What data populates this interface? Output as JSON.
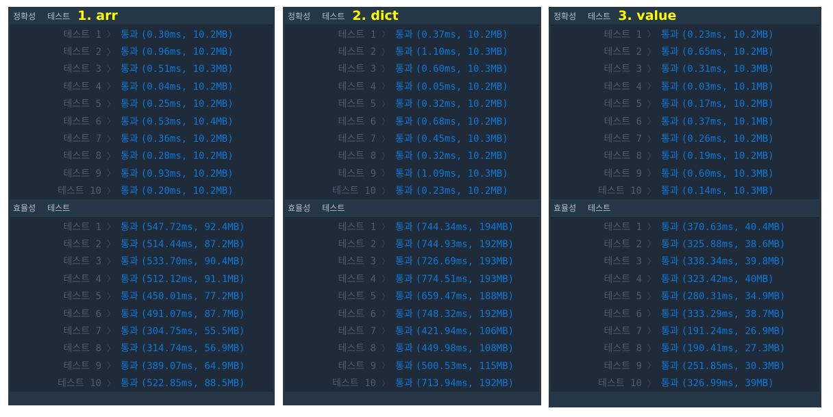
{
  "panels": [
    {
      "annotation": "1. arr",
      "accuracy": {
        "title": "정확성",
        "subtitle": "테스트",
        "rows": [
          {
            "label": "테스트 1",
            "status": "통과",
            "result": "(0.30ms, 10.2MB)"
          },
          {
            "label": "테스트 2",
            "status": "통과",
            "result": "(0.96ms, 10.2MB)"
          },
          {
            "label": "테스트 3",
            "status": "통과",
            "result": "(0.51ms, 10.3MB)"
          },
          {
            "label": "테스트 4",
            "status": "통과",
            "result": "(0.04ms, 10.2MB)"
          },
          {
            "label": "테스트 5",
            "status": "통과",
            "result": "(0.25ms, 10.2MB)"
          },
          {
            "label": "테스트 6",
            "status": "통과",
            "result": "(0.53ms, 10.4MB)"
          },
          {
            "label": "테스트 7",
            "status": "통과",
            "result": "(0.36ms, 10.2MB)"
          },
          {
            "label": "테스트 8",
            "status": "통과",
            "result": "(0.28ms, 10.2MB)"
          },
          {
            "label": "테스트 9",
            "status": "통과",
            "result": "(0.93ms, 10.2MB)"
          },
          {
            "label": "테스트 10",
            "status": "통과",
            "result": "(0.20ms, 10.2MB)"
          }
        ]
      },
      "efficiency": {
        "title": "효율성",
        "subtitle": "테스트",
        "rows": [
          {
            "label": "테스트 1",
            "status": "통과",
            "result": "(547.72ms, 92.4MB)"
          },
          {
            "label": "테스트 2",
            "status": "통과",
            "result": "(514.44ms, 87.2MB)"
          },
          {
            "label": "테스트 3",
            "status": "통과",
            "result": "(533.70ms, 90.4MB)"
          },
          {
            "label": "테스트 4",
            "status": "통과",
            "result": "(512.12ms, 91.1MB)"
          },
          {
            "label": "테스트 5",
            "status": "통과",
            "result": "(450.01ms, 77.2MB)"
          },
          {
            "label": "테스트 6",
            "status": "통과",
            "result": "(491.07ms, 87.7MB)"
          },
          {
            "label": "테스트 7",
            "status": "통과",
            "result": "(304.75ms, 55.5MB)"
          },
          {
            "label": "테스트 8",
            "status": "통과",
            "result": "(314.74ms, 56.9MB)"
          },
          {
            "label": "테스트 9",
            "status": "통과",
            "result": "(389.07ms, 64.9MB)"
          },
          {
            "label": "테스트 10",
            "status": "통과",
            "result": "(522.85ms, 88.5MB)"
          }
        ]
      }
    },
    {
      "annotation": "2. dict",
      "accuracy": {
        "title": "정확성",
        "subtitle": "테스트",
        "rows": [
          {
            "label": "테스트 1",
            "status": "통과",
            "result": "(0.37ms, 10.2MB)"
          },
          {
            "label": "테스트 2",
            "status": "통과",
            "result": "(1.10ms, 10.3MB)"
          },
          {
            "label": "테스트 3",
            "status": "통과",
            "result": "(0.60ms, 10.3MB)"
          },
          {
            "label": "테스트 4",
            "status": "통과",
            "result": "(0.05ms, 10.2MB)"
          },
          {
            "label": "테스트 5",
            "status": "통과",
            "result": "(0.32ms, 10.2MB)"
          },
          {
            "label": "테스트 6",
            "status": "통과",
            "result": "(0.68ms, 10.2MB)"
          },
          {
            "label": "테스트 7",
            "status": "통과",
            "result": "(0.45ms, 10.3MB)"
          },
          {
            "label": "테스트 8",
            "status": "통과",
            "result": "(0.32ms, 10.2MB)"
          },
          {
            "label": "테스트 9",
            "status": "통과",
            "result": "(1.09ms, 10.3MB)"
          },
          {
            "label": "테스트 10",
            "status": "통과",
            "result": "(0.23ms, 10.2MB)"
          }
        ]
      },
      "efficiency": {
        "title": "효율성",
        "subtitle": "테스트",
        "rows": [
          {
            "label": "테스트 1",
            "status": "통과",
            "result": "(744.34ms, 194MB)"
          },
          {
            "label": "테스트 2",
            "status": "통과",
            "result": "(744.93ms, 192MB)"
          },
          {
            "label": "테스트 3",
            "status": "통과",
            "result": "(726.69ms, 193MB)"
          },
          {
            "label": "테스트 4",
            "status": "통과",
            "result": "(774.51ms, 193MB)"
          },
          {
            "label": "테스트 5",
            "status": "통과",
            "result": "(659.47ms, 188MB)"
          },
          {
            "label": "테스트 6",
            "status": "통과",
            "result": "(748.32ms, 192MB)"
          },
          {
            "label": "테스트 7",
            "status": "통과",
            "result": "(421.94ms, 106MB)"
          },
          {
            "label": "테스트 8",
            "status": "통과",
            "result": "(449.98ms, 108MB)"
          },
          {
            "label": "테스트 9",
            "status": "통과",
            "result": "(500.53ms, 115MB)"
          },
          {
            "label": "테스트 10",
            "status": "통과",
            "result": "(713.94ms, 192MB)"
          }
        ]
      }
    },
    {
      "annotation": "3. value",
      "accuracy": {
        "title": "정확성",
        "subtitle": "테스트",
        "rows": [
          {
            "label": "테스트 1",
            "status": "통과",
            "result": "(0.23ms, 10.2MB)"
          },
          {
            "label": "테스트 2",
            "status": "통과",
            "result": "(0.65ms, 10.2MB)"
          },
          {
            "label": "테스트 3",
            "status": "통과",
            "result": "(0.31ms, 10.3MB)"
          },
          {
            "label": "테스트 4",
            "status": "통과",
            "result": "(0.03ms, 10.1MB)"
          },
          {
            "label": "테스트 5",
            "status": "통과",
            "result": "(0.17ms, 10.2MB)"
          },
          {
            "label": "테스트 6",
            "status": "통과",
            "result": "(0.37ms, 10.1MB)"
          },
          {
            "label": "테스트 7",
            "status": "통과",
            "result": "(0.26ms, 10.2MB)"
          },
          {
            "label": "테스트 8",
            "status": "통과",
            "result": "(0.19ms, 10.2MB)"
          },
          {
            "label": "테스트 9",
            "status": "통과",
            "result": "(0.60ms, 10.3MB)"
          },
          {
            "label": "테스트 10",
            "status": "통과",
            "result": "(0.14ms, 10.3MB)"
          }
        ]
      },
      "efficiency": {
        "title": "효율성",
        "subtitle": "테스트",
        "rows": [
          {
            "label": "테스트 1",
            "status": "통과",
            "result": "(370.63ms, 40.4MB)"
          },
          {
            "label": "테스트 2",
            "status": "통과",
            "result": "(325.88ms, 38.6MB)"
          },
          {
            "label": "테스트 3",
            "status": "통과",
            "result": "(338.34ms, 39.8MB)"
          },
          {
            "label": "테스트 4",
            "status": "통과",
            "result": "(323.42ms, 40MB)"
          },
          {
            "label": "테스트 5",
            "status": "통과",
            "result": "(280.31ms, 34.9MB)"
          },
          {
            "label": "테스트 6",
            "status": "통과",
            "result": "(333.29ms, 38.7MB)"
          },
          {
            "label": "테스트 7",
            "status": "통과",
            "result": "(191.24ms, 26.9MB)"
          },
          {
            "label": "테스트 8",
            "status": "통과",
            "result": "(190.41ms, 27.3MB)"
          },
          {
            "label": "테스트 9",
            "status": "통과",
            "result": "(251.85ms, 30.3MB)"
          },
          {
            "label": "테스트 10",
            "status": "통과",
            "result": "(326.99ms, 39MB)"
          }
        ]
      }
    }
  ],
  "colors": {
    "panel_bg": "#263747",
    "row_bg": "#1f2b38",
    "annotation": "#ffff00",
    "pass": "#0f78d8",
    "label": "#4e5e6d"
  }
}
